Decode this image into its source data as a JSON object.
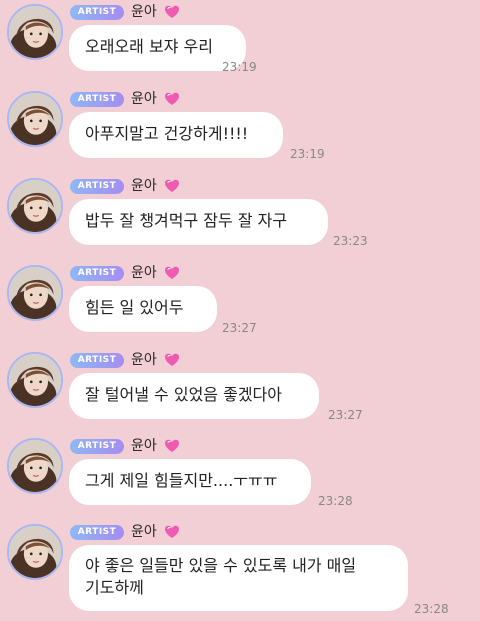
{
  "messages": [
    {
      "badge": "ARTIST",
      "sender": "윤아",
      "text": "오래오래 보쟈 우리",
      "time": "23:19"
    },
    {
      "badge": "ARTIST",
      "sender": "윤아",
      "text": "아푸지말고 건강하게!!!!",
      "time": "23:19"
    },
    {
      "badge": "ARTIST",
      "sender": "윤아",
      "text": "밥두 잘 챙겨먹구 잠두 잘 자구",
      "time": "23:23"
    },
    {
      "badge": "ARTIST",
      "sender": "윤아",
      "text": "힘든 일 있어두",
      "time": "23:27"
    },
    {
      "badge": "ARTIST",
      "sender": "윤아",
      "text": "잘 털어낼 수 있었음 좋겠다아",
      "time": "23:27"
    },
    {
      "badge": "ARTIST",
      "sender": "윤아",
      "text": "그게 제일 힘들지만....ㅜㅠㅠ",
      "time": "23:28"
    },
    {
      "badge": "ARTIST",
      "sender": "윤아",
      "text": "야 좋은 일들만 있을 수 있도록 내가 매일\n기도하께",
      "time": "23:28"
    }
  ],
  "colors": {
    "background": "#f2ced5",
    "bubble": "#ffffff",
    "badge_gradient_start": "#8fb7f4",
    "badge_gradient_end": "#a58df0",
    "heart": "#ef5bb0",
    "time": "#888888"
  },
  "icons": {
    "avatar": "profile-photo",
    "heart": "pink-heart-icon"
  }
}
